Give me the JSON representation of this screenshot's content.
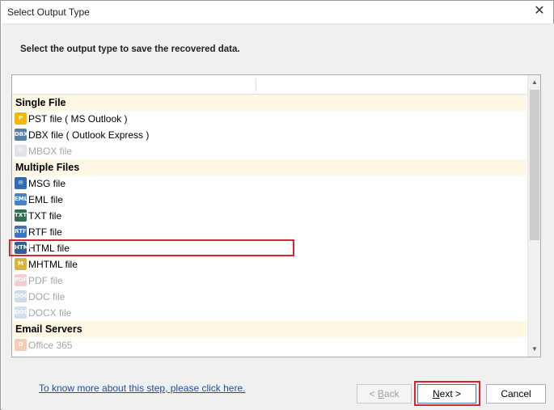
{
  "window": {
    "title": "Select Output Type",
    "close_glyph": "✕"
  },
  "instruction": "Select the output type to save the recovered data.",
  "list": {
    "groups": [
      {
        "label": "Single File",
        "items": [
          {
            "label": "PST file ( MS Outlook )",
            "icon": "pst-icon",
            "enabled": true
          },
          {
            "label": "DBX file ( Outlook Express )",
            "icon": "dbx-icon",
            "enabled": true
          },
          {
            "label": "MBOX file",
            "icon": "mbox-icon",
            "enabled": false
          }
        ]
      },
      {
        "label": "Multiple Files",
        "items": [
          {
            "label": "MSG file",
            "icon": "msg-icon",
            "enabled": true
          },
          {
            "label": "EML file",
            "icon": "eml-icon",
            "enabled": true
          },
          {
            "label": "TXT file",
            "icon": "txt-icon",
            "enabled": true
          },
          {
            "label": "RTF file",
            "icon": "rtf-icon",
            "enabled": true
          },
          {
            "label": "HTML file",
            "icon": "html-icon",
            "enabled": true,
            "selected": true
          },
          {
            "label": "MHTML file",
            "icon": "mhtml-icon",
            "enabled": true
          },
          {
            "label": "PDF file",
            "icon": "pdf-icon",
            "enabled": false
          },
          {
            "label": "DOC file",
            "icon": "doc-icon",
            "enabled": false
          },
          {
            "label": "DOCX file",
            "icon": "docx-icon",
            "enabled": false
          }
        ]
      },
      {
        "label": "Email Servers",
        "items": [
          {
            "label": "Office 365",
            "icon": "office365-icon",
            "enabled": false
          }
        ]
      }
    ],
    "scroll_up_glyph": "▲",
    "scroll_down_glyph": "▼"
  },
  "footer": {
    "help_link": "To know more about this step, please click here.",
    "back_button": {
      "prefix": "< ",
      "mnemonic": "B",
      "rest": "ack"
    },
    "next_button": {
      "mnemonic": "N",
      "rest": "ext >"
    },
    "cancel_button": "Cancel"
  },
  "colors": {
    "highlight": "#d9232d",
    "group_row_bg": "#fdf7e3",
    "link": "#1f4e9e"
  }
}
